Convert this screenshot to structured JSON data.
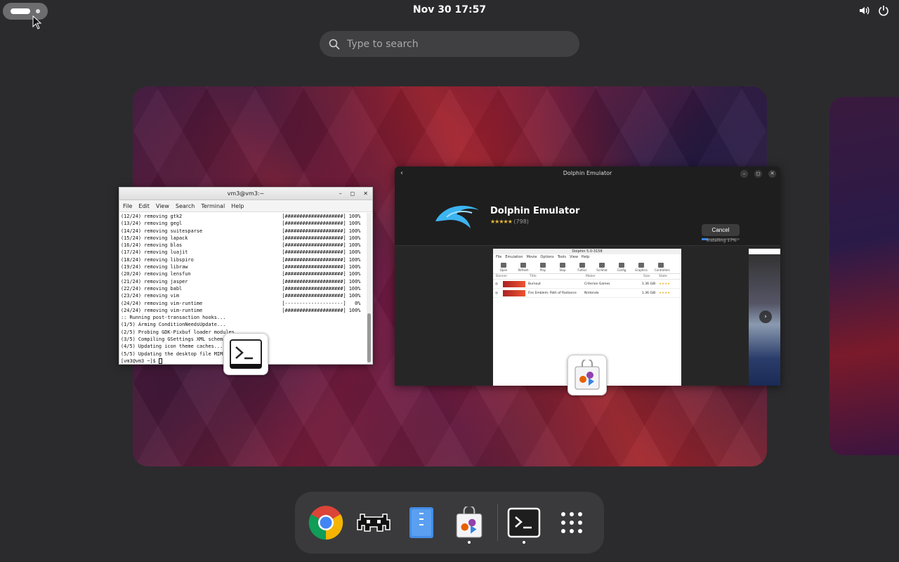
{
  "topbar": {
    "clock": "Nov 30  17:57",
    "icons": [
      "volume-icon",
      "power-icon"
    ]
  },
  "search": {
    "placeholder": "Type to search"
  },
  "terminal": {
    "title": "vm3@vm3:~",
    "controls": [
      "–",
      "◻",
      "✕"
    ],
    "menu": [
      "File",
      "Edit",
      "View",
      "Search",
      "Terminal",
      "Help"
    ],
    "lines": [
      {
        "left": "(12/24) removing gtk2",
        "right": "[####################] 100%"
      },
      {
        "left": "(13/24) removing gegl",
        "right": "[####################] 100%"
      },
      {
        "left": "(14/24) removing suitesparse",
        "right": "[####################] 100%"
      },
      {
        "left": "(15/24) removing lapack",
        "right": "[####################] 100%"
      },
      {
        "left": "(16/24) removing blas",
        "right": "[####################] 100%"
      },
      {
        "left": "(17/24) removing luajit",
        "right": "[####################] 100%"
      },
      {
        "left": "(18/24) removing libspiro",
        "right": "[####################] 100%"
      },
      {
        "left": "(19/24) removing libraw",
        "right": "[####################] 100%"
      },
      {
        "left": "(20/24) removing lensfun",
        "right": "[####################] 100%"
      },
      {
        "left": "(21/24) removing jasper",
        "right": "[####################] 100%"
      },
      {
        "left": "(22/24) removing babl",
        "right": "[####################] 100%"
      },
      {
        "left": "(23/24) removing vim",
        "right": "[####################] 100%"
      },
      {
        "left": "(24/24) removing vim-runtime",
        "right": "[--------------------]   0%"
      },
      {
        "left": "(24/24) removing vim-runtime",
        "right": "[####################] 100%"
      },
      {
        "left": ":: Running post-transaction hooks...",
        "right": ""
      },
      {
        "left": "(1/5) Arming ConditionNeedsUpdate...",
        "right": ""
      },
      {
        "left": "(2/5) Probing GDK-Pixbuf loader modules...",
        "right": ""
      },
      {
        "left": "(3/5) Compiling GSettings XML schema files...",
        "right": ""
      },
      {
        "left": "(4/5) Updating icon theme caches...",
        "right": ""
      },
      {
        "left": "(5/5) Updating the desktop file MIME type cache...",
        "right": ""
      }
    ],
    "prompt": "[vm3@vm3 ~]$ "
  },
  "dolphin": {
    "window_title": "Dolphin Emulator",
    "app_name": "Dolphin Emulator",
    "stars": "★★★★★",
    "rating_count": "(798)",
    "cancel_label": "Cancel",
    "progress_text": "Installing 17%",
    "progress": 0.17,
    "screenshot": {
      "title": "Dolphin 5.0-3158",
      "menu": [
        "File",
        "Emulation",
        "Movie",
        "Options",
        "Tools",
        "View",
        "Help"
      ],
      "tools": [
        "Open",
        "Refresh",
        "Play",
        "Stop",
        "FullScr",
        "ScrShot",
        "Config",
        "Graphics",
        "Controllers"
      ],
      "columns": [
        "Banner",
        "Title",
        "Maker",
        "Size",
        "State"
      ],
      "rows": [
        {
          "title": "Burnout",
          "maker": "Criterion Games",
          "size": "1.36 GiB"
        },
        {
          "title": "Fire Emblem: Path of Radiance",
          "maker": "Nintendo",
          "size": "1.36 GiB"
        }
      ]
    }
  },
  "dock": {
    "items": [
      {
        "name": "chrome-icon",
        "running": false
      },
      {
        "name": "retroarch-icon",
        "running": false
      },
      {
        "name": "files-icon",
        "running": false
      },
      {
        "name": "software-store-icon",
        "running": true
      },
      {
        "name": "terminal-icon",
        "running": true
      },
      {
        "name": "app-grid-icon",
        "running": false
      }
    ]
  },
  "colors": {
    "accent": "#3584e4",
    "panel": "#2b2b2d",
    "dock": "#3a3a3c"
  }
}
